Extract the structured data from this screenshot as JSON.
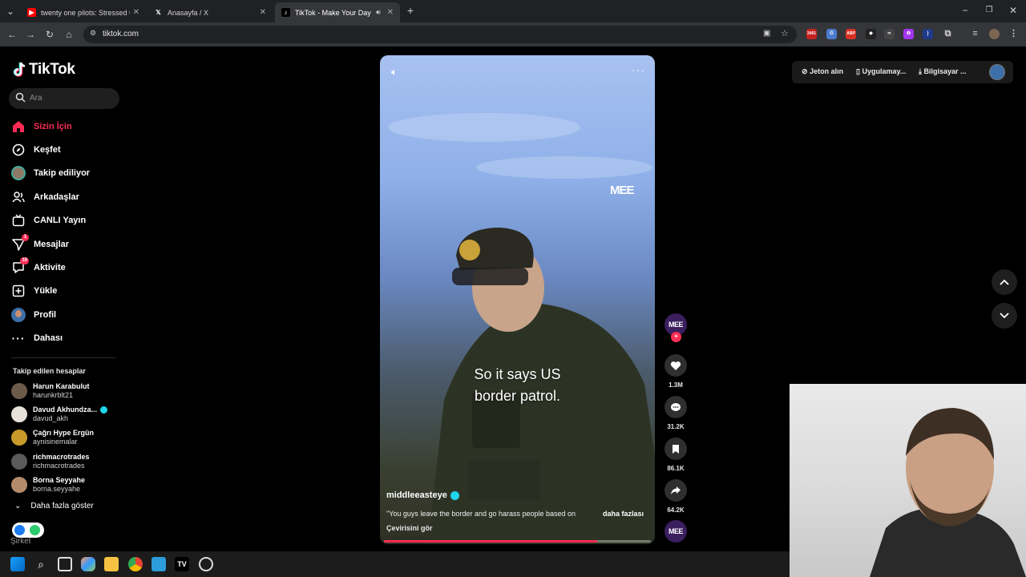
{
  "browser": {
    "tabs": [
      {
        "title": "twenty one pilots: Stressed Out",
        "active": false
      },
      {
        "title": "Anasayfa / X",
        "active": false
      },
      {
        "title": "TikTok - Make Your Day",
        "active": true
      }
    ],
    "url": "tiktok.com",
    "ext_badge": "2401"
  },
  "sidebar": {
    "logo": "TikTok",
    "search_placeholder": "Ara",
    "nav": [
      {
        "label": "Sizin İçin",
        "icon": "home-icon",
        "active": true,
        "badge": ""
      },
      {
        "label": "Keşfet",
        "icon": "compass-icon",
        "active": false,
        "badge": ""
      },
      {
        "label": "Takip ediliyor",
        "icon": "following-avatar-icon",
        "active": false,
        "badge": ""
      },
      {
        "label": "Arkadaşlar",
        "icon": "friends-icon",
        "active": false,
        "badge": ""
      },
      {
        "label": "CANLI Yayın",
        "icon": "live-icon",
        "active": false,
        "badge": ""
      },
      {
        "label": "Mesajlar",
        "icon": "messages-icon",
        "active": false,
        "badge": "1"
      },
      {
        "label": "Aktivite",
        "icon": "activity-icon",
        "active": false,
        "badge": "19"
      },
      {
        "label": "Yükle",
        "icon": "upload-icon",
        "active": false,
        "badge": ""
      },
      {
        "label": "Profil",
        "icon": "profile-icon",
        "active": false,
        "badge": ""
      },
      {
        "label": "Dahası",
        "icon": "more-icon",
        "active": false,
        "badge": ""
      }
    ],
    "following_title": "Takip edilen hesaplar",
    "following": [
      {
        "name": "Harun Karabulut",
        "handle": "harunkrblt21",
        "verified": false,
        "color": "#6d5b4a"
      },
      {
        "name": "Davud Akhundza...",
        "handle": "davud_akh",
        "verified": true,
        "color": "#8a7463"
      },
      {
        "name": "Çağrı Hype Ergün",
        "handle": "aynisinemalar",
        "verified": false,
        "color": "#c79a2a"
      },
      {
        "name": "richmacrotrades",
        "handle": "richmacrotrades",
        "verified": false,
        "color": "#5a5a5a"
      },
      {
        "name": "Borna Seyyahe",
        "handle": "borna.seyyahe",
        "verified": false,
        "color": "#b48b6a"
      }
    ],
    "show_more": "Daha fazla göster",
    "company": "Şirket"
  },
  "topbar": {
    "coins": "Jeton alın",
    "app": "Uygulamay...",
    "desktop": "Bilgisayar ..."
  },
  "video": {
    "caption_line1": "So it says US",
    "caption_line2": "border patrol.",
    "watermark": "MEE",
    "author": "middleeasteye",
    "description": "\"You guys leave the border and go harass people based on",
    "more_label": "daha fazlası",
    "translate": "Çevirisini gör",
    "progress": 0.8
  },
  "actions": {
    "avatar_label": "MEE",
    "likes": "1.3M",
    "comments": "31.2K",
    "saves": "86.1K",
    "shares": "64.2K"
  },
  "colors": {
    "accent": "#fe2c55",
    "background": "#000000",
    "verified": "#20d5ec"
  }
}
